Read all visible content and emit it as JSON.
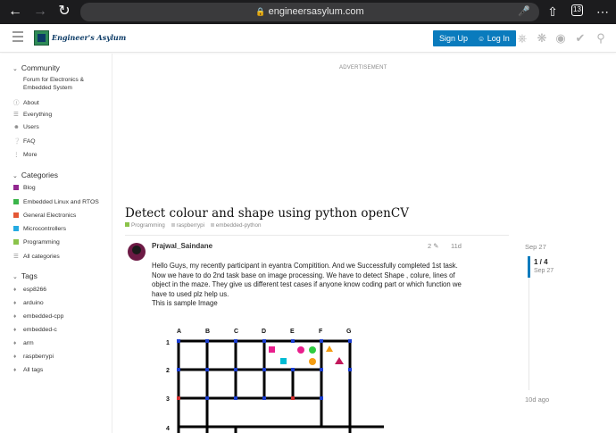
{
  "browser": {
    "url": "engineersasylum.com",
    "tab_count": "13"
  },
  "header": {
    "logo_text": "Engineer's Asylum",
    "signup_label": "Sign Up",
    "login_label": "Log In"
  },
  "sidebar": {
    "community": {
      "heading": "Community",
      "description": "Forum for Electronics & Embedded System",
      "items": [
        {
          "label": "About",
          "icon": "info-icon"
        },
        {
          "label": "Everything",
          "icon": "layers-icon"
        },
        {
          "label": "Users",
          "icon": "users-icon"
        },
        {
          "label": "FAQ",
          "icon": "question-icon"
        },
        {
          "label": "More",
          "icon": "more-icon"
        }
      ]
    },
    "categories": {
      "heading": "Categories",
      "items": [
        {
          "label": "Blog",
          "color": "#92278f"
        },
        {
          "label": "Embedded Linux and RTOS",
          "color": "#3ab54a"
        },
        {
          "label": "General Electronics",
          "color": "#e45735"
        },
        {
          "label": "Microcontrollers",
          "color": "#25aae2"
        },
        {
          "label": "Programming",
          "color": "#8bc34a"
        },
        {
          "label": "All categories",
          "icon": "list-icon"
        }
      ]
    },
    "tags": {
      "heading": "Tags",
      "items": [
        {
          "label": "esp8266"
        },
        {
          "label": "arduino"
        },
        {
          "label": "embedded-cpp"
        },
        {
          "label": "embedded-c"
        },
        {
          "label": "arm"
        },
        {
          "label": "raspberrypi"
        },
        {
          "label": "All tags"
        }
      ]
    }
  },
  "main": {
    "advertisement_label": "ADVERTISEMENT",
    "topic_title": "Detect colour and shape using python openCV",
    "category": "Programming",
    "tags": [
      "raspberrypi",
      "embedded-python"
    ],
    "post": {
      "username": "Prajwal_Saindane",
      "edit_count": "2",
      "date": "11d",
      "body_lines": [
        "Hello Guys, my recently participant in eyantra Compitition. And we Successfully completed 1st task.",
        "Now we have to do 2nd task base on image processing. We have to detect Shape , colure, lines of",
        "object in the maze. They give us different test cases if anyone know coding part or which function we",
        "have to used plz help us.",
        "This is sample Image"
      ],
      "maze_columns": [
        "A",
        "B",
        "C",
        "D",
        "E",
        "F",
        "G"
      ],
      "maze_rows": [
        "1",
        "2",
        "3",
        "4"
      ]
    }
  },
  "timeline": {
    "start_date": "Sep 27",
    "position": "1 / 4",
    "position_date": "Sep 27",
    "end_label": "10d ago"
  },
  "colors": {
    "accent": "#0a7bbd",
    "chrome_bg": "#1c1c1e"
  }
}
